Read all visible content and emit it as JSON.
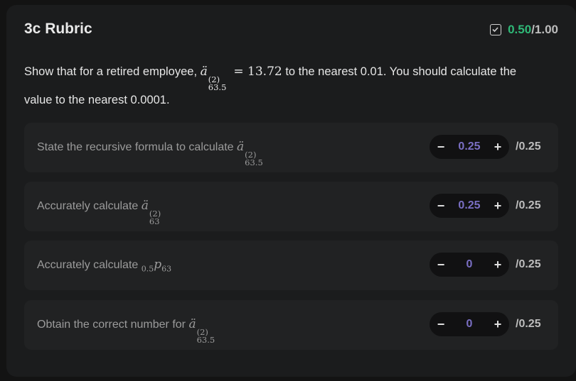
{
  "rubric": {
    "title": "3c Rubric",
    "score_earned": "0.50",
    "score_total": "/1.00",
    "prompt_part1": "Show that for a retired employee,",
    "prompt_value": "13.72",
    "prompt_part2": "to the nearest 0.01. You should calculate the value to the nearest 0.0001.",
    "items": [
      {
        "label": "State the recursive formula to calculate",
        "value": "0.25",
        "max": "/0.25"
      },
      {
        "label": "Accurately calculate",
        "value": "0.25",
        "max": "/0.25"
      },
      {
        "label": "Accurately calculate",
        "value": "0",
        "max": "/0.25"
      },
      {
        "label": "Obtain the correct number for",
        "value": "0",
        "max": "/0.25"
      }
    ],
    "minus_symbol": "−",
    "plus_symbol": "+"
  },
  "colors": {
    "accent": "#7a6fc4",
    "success": "#2fb877"
  }
}
